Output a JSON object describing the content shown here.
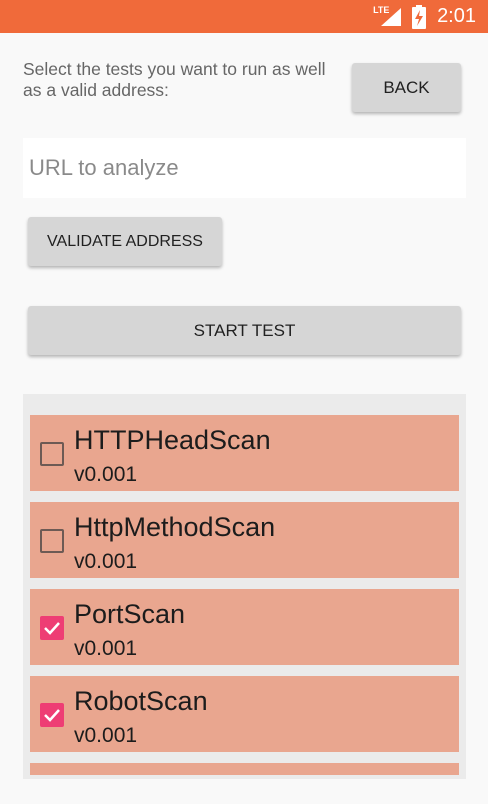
{
  "status_bar": {
    "network_label": "LTE",
    "time": "2:01",
    "color": "#f06a3a"
  },
  "header": {
    "instructions": "Select the tests you want to run as well as a valid address:",
    "back_label": "BACK"
  },
  "url_input": {
    "placeholder": "URL to analyze",
    "value": ""
  },
  "buttons": {
    "validate_label": "VALIDATE ADDRESS",
    "start_label": "START TEST"
  },
  "tests": [
    {
      "name": "HTTPHeadScan",
      "version": "v0.001",
      "checked": false
    },
    {
      "name": "HttpMethodScan",
      "version": "v0.001",
      "checked": false
    },
    {
      "name": "PortScan",
      "version": "v0.001",
      "checked": true
    },
    {
      "name": "RobotScan",
      "version": "v0.001",
      "checked": true
    }
  ],
  "colors": {
    "item_background": "#e9a68f",
    "checkbox_checked": "#ee3d74"
  }
}
